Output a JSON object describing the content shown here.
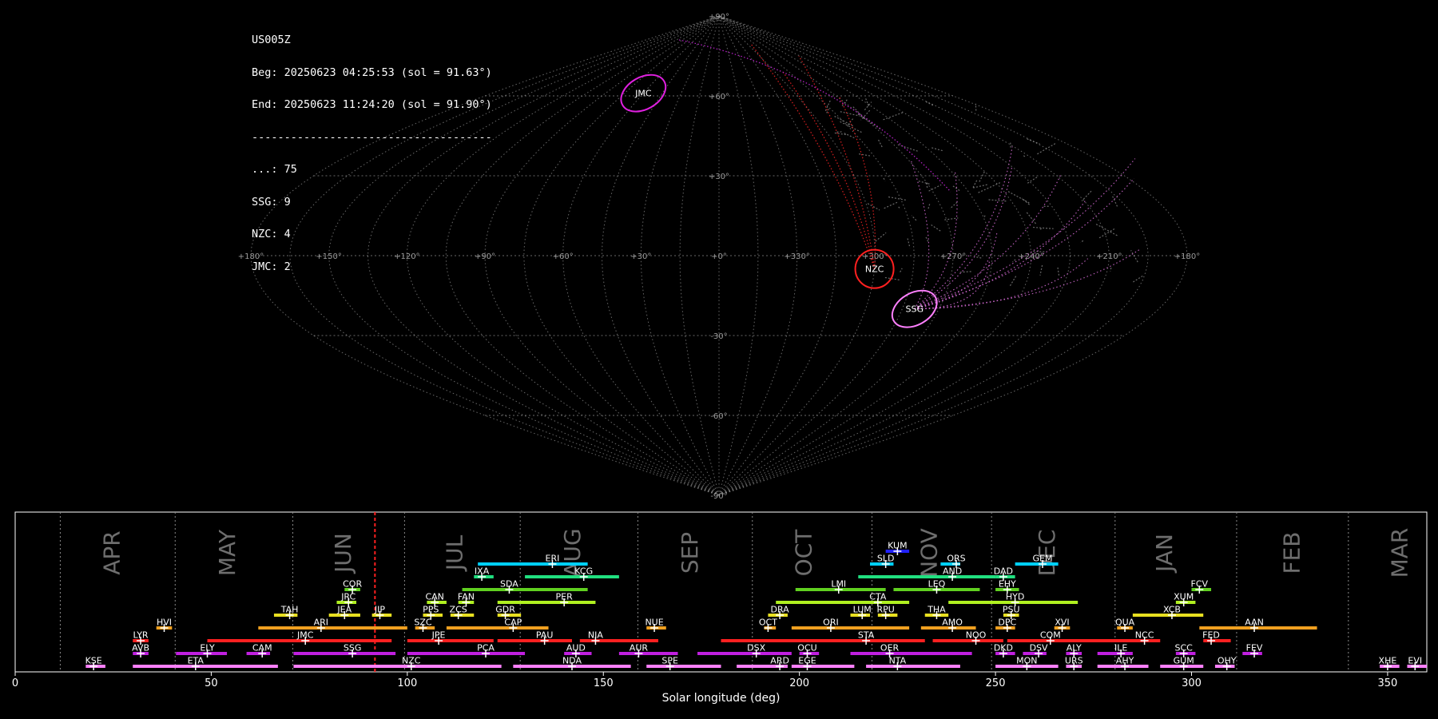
{
  "info": {
    "station": "US005Z",
    "begin": "Beg: 20250623 04:25:53 (sol = 91.63°)",
    "end": "End: 20250623 11:24:20 (sol = 91.90°)",
    "separator": "-------------------------------------",
    "counts": [
      {
        "code": "...",
        "count": "75"
      },
      {
        "code": "SSG",
        "count": "9"
      },
      {
        "code": "NZC",
        "count": "4"
      },
      {
        "code": "JMC",
        "count": "2"
      }
    ]
  },
  "sky_map": {
    "projection": "sinusoidal",
    "lon_tick_labels": [
      "+180°",
      "+150°",
      "+120°",
      "+90°",
      "+60°",
      "+30°",
      "+0°",
      "+330°",
      "+300°",
      "+270°",
      "+240°",
      "+210°",
      "+180°"
    ],
    "lat_tick_labels": [
      "+90°",
      "+60°",
      "+30°",
      "-30°",
      "-60°",
      "-90°"
    ],
    "radiants": [
      {
        "label": "JMC",
        "lon": 60,
        "lat": 61,
        "color": "#e020e0"
      },
      {
        "label": "NZC",
        "lon": 300,
        "lat": -5,
        "color": "#ff2020"
      },
      {
        "label": "SSG",
        "lon": 280,
        "lat": -20,
        "color": "#ff80ff"
      }
    ]
  },
  "chart_data": {
    "type": "timeline",
    "xlabel": "Solar longitude (deg)",
    "xlim": [
      0,
      360
    ],
    "x_ticks": [
      0,
      50,
      100,
      150,
      200,
      250,
      300,
      350
    ],
    "current_sol": 91.75,
    "months": [
      {
        "label": "APR",
        "start": 11.5,
        "center": 24.5
      },
      {
        "label": "MAY",
        "start": 40.8,
        "center": 54
      },
      {
        "label": "JUN",
        "start": 70.8,
        "center": 83.5
      },
      {
        "label": "JUL",
        "start": 99.3,
        "center": 112
      },
      {
        "label": "AUG",
        "start": 128.8,
        "center": 142
      },
      {
        "label": "SEP",
        "start": 158.8,
        "center": 172
      },
      {
        "label": "OCT",
        "start": 188,
        "center": 201
      },
      {
        "label": "NOV",
        "start": 218.5,
        "center": 233
      },
      {
        "label": "DEC",
        "start": 249,
        "center": 263
      },
      {
        "label": "JAN",
        "start": 280.5,
        "center": 293
      },
      {
        "label": "FEB",
        "start": 311.5,
        "center": 325.5
      },
      {
        "label": "MAR",
        "start": 340,
        "center": 353
      }
    ],
    "showers": [
      {
        "code": "KUM",
        "start": 222,
        "end": 228,
        "peak": 225,
        "row": 10,
        "color": "#2020ff"
      },
      {
        "code": "ERI",
        "start": 118,
        "end": 146,
        "peak": 137,
        "row": 9,
        "color": "#00d0ff"
      },
      {
        "code": "SLD",
        "start": 218,
        "end": 224,
        "peak": 222,
        "row": 9,
        "color": "#00d0ff"
      },
      {
        "code": "ORS",
        "start": 236,
        "end": 241,
        "peak": 240,
        "row": 9,
        "color": "#00d0ff"
      },
      {
        "code": "GEM",
        "start": 255,
        "end": 266,
        "peak": 262,
        "row": 9,
        "color": "#00d0ff"
      },
      {
        "code": "IXA",
        "start": 117,
        "end": 122,
        "peak": 119,
        "row": 8,
        "color": "#20e080"
      },
      {
        "code": "KCG",
        "start": 130,
        "end": 154,
        "peak": 145,
        "row": 8,
        "color": "#20e080"
      },
      {
        "code": "AND",
        "start": 215,
        "end": 250,
        "peak": 239,
        "row": 8,
        "color": "#20e080"
      },
      {
        "code": "DAD",
        "start": 250,
        "end": 255,
        "peak": 252,
        "row": 8,
        "color": "#20e080"
      },
      {
        "code": "COR",
        "start": 84,
        "end": 88,
        "peak": 86,
        "row": 7,
        "color": "#60d020"
      },
      {
        "code": "SDA",
        "start": 114,
        "end": 146,
        "peak": 126,
        "row": 7,
        "color": "#60d020"
      },
      {
        "code": "LMI",
        "start": 199,
        "end": 222,
        "peak": 210,
        "row": 7,
        "color": "#60d020"
      },
      {
        "code": "LEQ",
        "start": 224,
        "end": 246,
        "peak": 235,
        "row": 7,
        "color": "#60d020"
      },
      {
        "code": "EHY",
        "start": 250,
        "end": 256,
        "peak": 253,
        "row": 7,
        "color": "#60d020"
      },
      {
        "code": "FCV",
        "start": 300,
        "end": 305,
        "peak": 302,
        "row": 7,
        "color": "#60d020"
      },
      {
        "code": "JRC",
        "start": 82,
        "end": 87,
        "peak": 85,
        "row": 6,
        "color": "#b0f020"
      },
      {
        "code": "CAN",
        "start": 105,
        "end": 110,
        "peak": 107,
        "row": 6,
        "color": "#b0f020"
      },
      {
        "code": "FAN",
        "start": 113,
        "end": 117,
        "peak": 115,
        "row": 6,
        "color": "#b0f020"
      },
      {
        "code": "PER",
        "start": 123,
        "end": 148,
        "peak": 140,
        "row": 6,
        "color": "#b0f020"
      },
      {
        "code": "CTA",
        "start": 194,
        "end": 228,
        "peak": 220,
        "row": 6,
        "color": "#b0f020"
      },
      {
        "code": "HYD",
        "start": 238,
        "end": 271,
        "peak": 255,
        "row": 6,
        "color": "#b0f020"
      },
      {
        "code": "XUM",
        "start": 296,
        "end": 301,
        "peak": 298,
        "row": 6,
        "color": "#b0f020"
      },
      {
        "code": "TAH",
        "start": 66,
        "end": 72,
        "peak": 70,
        "row": 5,
        "color": "#e8e020"
      },
      {
        "code": "JEA",
        "start": 80,
        "end": 88,
        "peak": 84,
        "row": 5,
        "color": "#e8e020"
      },
      {
        "code": "JIP",
        "start": 91,
        "end": 96,
        "peak": 93,
        "row": 5,
        "color": "#e8e020"
      },
      {
        "code": "PPS",
        "start": 104,
        "end": 109,
        "peak": 106,
        "row": 5,
        "color": "#e8e020"
      },
      {
        "code": "ZCS",
        "start": 111,
        "end": 117,
        "peak": 113,
        "row": 5,
        "color": "#e8e020"
      },
      {
        "code": "GDR",
        "start": 123,
        "end": 129,
        "peak": 125,
        "row": 5,
        "color": "#e8e020"
      },
      {
        "code": "DRA",
        "start": 192,
        "end": 197,
        "peak": 195,
        "row": 5,
        "color": "#e8e020"
      },
      {
        "code": "LUM",
        "start": 213,
        "end": 218,
        "peak": 216,
        "row": 5,
        "color": "#e8e020"
      },
      {
        "code": "RPU",
        "start": 220,
        "end": 225,
        "peak": 222,
        "row": 5,
        "color": "#e8e020"
      },
      {
        "code": "THA",
        "start": 232,
        "end": 238,
        "peak": 235,
        "row": 5,
        "color": "#e8e020"
      },
      {
        "code": "PSU",
        "start": 252,
        "end": 256,
        "peak": 254,
        "row": 5,
        "color": "#e8e020"
      },
      {
        "code": "XCB",
        "start": 285,
        "end": 303,
        "peak": 295,
        "row": 5,
        "color": "#e8e020"
      },
      {
        "code": "HVI",
        "start": 36,
        "end": 40,
        "peak": 38,
        "row": 4,
        "color": "#f0a020"
      },
      {
        "code": "ARI",
        "start": 62,
        "end": 100,
        "peak": 78,
        "row": 4,
        "color": "#f0a020"
      },
      {
        "code": "SZC",
        "start": 102,
        "end": 107,
        "peak": 104,
        "row": 4,
        "color": "#f0a020"
      },
      {
        "code": "CAP",
        "start": 110,
        "end": 136,
        "peak": 127,
        "row": 4,
        "color": "#f0a020"
      },
      {
        "code": "NUE",
        "start": 161,
        "end": 166,
        "peak": 163,
        "row": 4,
        "color": "#f0a020"
      },
      {
        "code": "OCT",
        "start": 191,
        "end": 194,
        "peak": 192,
        "row": 4,
        "color": "#f0a020"
      },
      {
        "code": "ORI",
        "start": 198,
        "end": 228,
        "peak": 208,
        "row": 4,
        "color": "#f0a020"
      },
      {
        "code": "AMO",
        "start": 231,
        "end": 245,
        "peak": 239,
        "row": 4,
        "color": "#f0a020"
      },
      {
        "code": "DPC",
        "start": 250,
        "end": 255,
        "peak": 253,
        "row": 4,
        "color": "#f0a020"
      },
      {
        "code": "XVI",
        "start": 265,
        "end": 269,
        "peak": 267,
        "row": 4,
        "color": "#f0a020"
      },
      {
        "code": "QUA",
        "start": 281,
        "end": 285,
        "peak": 283,
        "row": 4,
        "color": "#f0a020"
      },
      {
        "code": "AAN",
        "start": 302,
        "end": 332,
        "peak": 316,
        "row": 4,
        "color": "#f0a020"
      },
      {
        "code": "LYR",
        "start": 30,
        "end": 34,
        "peak": 32,
        "row": 3,
        "color": "#ff2020"
      },
      {
        "code": "JMC",
        "start": 49,
        "end": 96,
        "peak": 74,
        "row": 3,
        "color": "#ff2020"
      },
      {
        "code": "JPE",
        "start": 100,
        "end": 122,
        "peak": 108,
        "row": 3,
        "color": "#ff2020"
      },
      {
        "code": "PAU",
        "start": 123,
        "end": 142,
        "peak": 135,
        "row": 3,
        "color": "#ff2020"
      },
      {
        "code": "NIA",
        "start": 144,
        "end": 164,
        "peak": 148,
        "row": 3,
        "color": "#ff2020"
      },
      {
        "code": "STA",
        "start": 180,
        "end": 232,
        "peak": 217,
        "row": 3,
        "color": "#ff2020"
      },
      {
        "code": "NOO",
        "start": 234,
        "end": 252,
        "peak": 245,
        "row": 3,
        "color": "#ff2020"
      },
      {
        "code": "COM",
        "start": 253,
        "end": 292,
        "peak": 264,
        "row": 3,
        "color": "#ff2020"
      },
      {
        "code": "NCC",
        "start": 286,
        "end": 291,
        "peak": 288,
        "row": 3,
        "color": "#ff2020"
      },
      {
        "code": "FED",
        "start": 303,
        "end": 310,
        "peak": 305,
        "row": 3,
        "color": "#ff2020"
      },
      {
        "code": "AVB",
        "start": 30,
        "end": 34,
        "peak": 32,
        "row": 2,
        "color": "#c020e0"
      },
      {
        "code": "ELY",
        "start": 41,
        "end": 54,
        "peak": 49,
        "row": 2,
        "color": "#c020e0"
      },
      {
        "code": "CAM",
        "start": 59,
        "end": 65,
        "peak": 63,
        "row": 2,
        "color": "#c020e0"
      },
      {
        "code": "SSG",
        "start": 71,
        "end": 97,
        "peak": 86,
        "row": 2,
        "color": "#c020e0"
      },
      {
        "code": "PCA",
        "start": 100,
        "end": 130,
        "peak": 120,
        "row": 2,
        "color": "#c020e0"
      },
      {
        "code": "AUD",
        "start": 140,
        "end": 147,
        "peak": 143,
        "row": 2,
        "color": "#c020e0"
      },
      {
        "code": "AUR",
        "start": 154,
        "end": 169,
        "peak": 159,
        "row": 2,
        "color": "#c020e0"
      },
      {
        "code": "DSX",
        "start": 174,
        "end": 198,
        "peak": 189,
        "row": 2,
        "color": "#c020e0"
      },
      {
        "code": "OCU",
        "start": 200,
        "end": 205,
        "peak": 202,
        "row": 2,
        "color": "#c020e0"
      },
      {
        "code": "OER",
        "start": 213,
        "end": 244,
        "peak": 223,
        "row": 2,
        "color": "#c020e0"
      },
      {
        "code": "DKD",
        "start": 250,
        "end": 255,
        "peak": 252,
        "row": 2,
        "color": "#c020e0"
      },
      {
        "code": "DSV",
        "start": 257,
        "end": 263,
        "peak": 261,
        "row": 2,
        "color": "#c020e0"
      },
      {
        "code": "ALY",
        "start": 268,
        "end": 272,
        "peak": 270,
        "row": 2,
        "color": "#c020e0"
      },
      {
        "code": "ILE",
        "start": 276,
        "end": 285,
        "peak": 282,
        "row": 2,
        "color": "#c020e0"
      },
      {
        "code": "SCC",
        "start": 296,
        "end": 301,
        "peak": 298,
        "row": 2,
        "color": "#c020e0"
      },
      {
        "code": "FEV",
        "start": 313,
        "end": 318,
        "peak": 316,
        "row": 2,
        "color": "#c020e0"
      },
      {
        "code": "KSE",
        "start": 18,
        "end": 23,
        "peak": 20,
        "row": 1,
        "color": "#ff80ff"
      },
      {
        "code": "ETA",
        "start": 30,
        "end": 67,
        "peak": 46,
        "row": 1,
        "color": "#ff80ff"
      },
      {
        "code": "NZC",
        "start": 71,
        "end": 124,
        "peak": 101,
        "row": 1,
        "color": "#ff80ff"
      },
      {
        "code": "NDA",
        "start": 127,
        "end": 157,
        "peak": 142,
        "row": 1,
        "color": "#ff80ff"
      },
      {
        "code": "SPE",
        "start": 161,
        "end": 180,
        "peak": 167,
        "row": 1,
        "color": "#ff80ff"
      },
      {
        "code": "ARD",
        "start": 184,
        "end": 197,
        "peak": 195,
        "row": 1,
        "color": "#ff80ff"
      },
      {
        "code": "EGE",
        "start": 198,
        "end": 214,
        "peak": 202,
        "row": 1,
        "color": "#ff80ff"
      },
      {
        "code": "NTA",
        "start": 217,
        "end": 241,
        "peak": 225,
        "row": 1,
        "color": "#ff80ff"
      },
      {
        "code": "MON",
        "start": 250,
        "end": 266,
        "peak": 258,
        "row": 1,
        "color": "#ff80ff"
      },
      {
        "code": "URS",
        "start": 268,
        "end": 272,
        "peak": 270,
        "row": 1,
        "color": "#ff80ff"
      },
      {
        "code": "AHY",
        "start": 276,
        "end": 289,
        "peak": 283,
        "row": 1,
        "color": "#ff80ff"
      },
      {
        "code": "GUM",
        "start": 292,
        "end": 303,
        "peak": 298,
        "row": 1,
        "color": "#ff80ff"
      },
      {
        "code": "OHY",
        "start": 306,
        "end": 311,
        "peak": 309,
        "row": 1,
        "color": "#ff80ff"
      },
      {
        "code": "XHE",
        "start": 348,
        "end": 353,
        "peak": 350,
        "row": 1,
        "color": "#ff80ff"
      },
      {
        "code": "EVI",
        "start": 355,
        "end": 360,
        "peak": 357,
        "row": 1,
        "color": "#ff80ff"
      }
    ]
  }
}
